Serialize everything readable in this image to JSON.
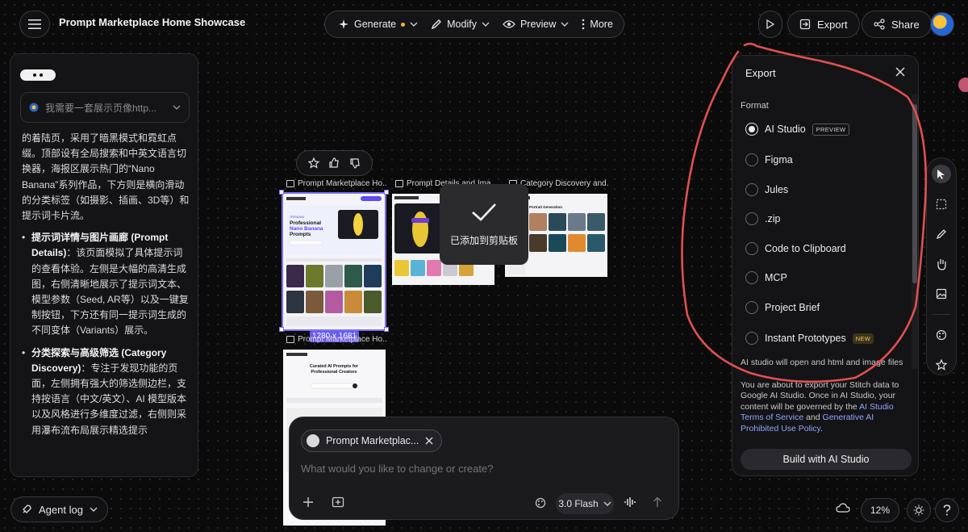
{
  "header": {
    "project_title": "Prompt Marketplace Home Showcase",
    "toolbar": {
      "generate": "Generate",
      "modify": "Modify",
      "preview": "Preview",
      "more": "More"
    },
    "export_label": "Export",
    "share_label": "Share"
  },
  "left_panel": {
    "prompt_preview": "我需要一套展示页像http...",
    "intro_text": "的着陆页，采用了暗黑模式和霓虹点缀。顶部设有全局搜索和中英文语言切换器，海报区展示热门的“Nano Banana”系列作品，下方则是横向滑动的分类标签（如摄影、插画、3D等）和提示词卡片流。",
    "bullets": [
      {
        "title": "提示词详情与图片画廊 (Prompt Details)",
        "body": "：该页面模拟了具体提示词的查看体验。左侧是大幅的高清生成图，右侧清晰地展示了提示词文本、模型参数（Seed, AR等）以及一键复制按钮，下方还有同一提示词生成的不同变体（Variants）展示。"
      },
      {
        "title": "分类探索与高级筛选 (Category Discovery)",
        "body": "：专注于发现功能的页面，左侧拥有强大的筛选侧边栏，支持按语言（中文/英文）、AI 模型版本以及风格进行多维度过滤，右侧则采用瀑布流布局展示精选提示"
      }
    ],
    "agent_log": "Agent log"
  },
  "canvas": {
    "artboards": [
      {
        "label": "Prompt Marketplace Ho...",
        "heading": "Professional Nano Banana Prompts"
      },
      {
        "label": "Prompt Details and Ima..."
      },
      {
        "label": "Category Discovery and...",
        "heading": "Portrait Generation"
      },
      {
        "label": "Prompt Marketplace Ho...",
        "heading": "Curated AI Prompts for Professional Creators"
      }
    ],
    "selection_size": "1280 x 1681",
    "toast": "已添加到剪贴板"
  },
  "chat": {
    "chip_label": "Prompt Marketplac...",
    "placeholder": "What would you like to change or create?",
    "model": "3.0 Flash"
  },
  "export_panel": {
    "title": "Export",
    "format_label": "Format",
    "options": [
      {
        "label": "AI Studio",
        "tag": "PREVIEW",
        "selected": true
      },
      {
        "label": "Figma",
        "selected": false
      },
      {
        "label": "Jules",
        "selected": false
      },
      {
        "label": ".zip",
        "selected": false
      },
      {
        "label": "Code to Clipboard",
        "selected": false
      },
      {
        "label": "MCP",
        "selected": false
      },
      {
        "label": "Project Brief",
        "selected": false
      },
      {
        "label": "Instant Prototypes",
        "tag": "NEW",
        "selected": false
      }
    ],
    "note": "AI studio will open and html and image files",
    "notice_prefix": "You are about to export your Stitch data to Google AI Studio. Once in AI Studio, your content will be governed by the ",
    "terms_link": "AI Studio Terms of Service",
    "notice_and": " and ",
    "policy_link": "Generative AI Prohibited Use Policy",
    "notice_suffix": ".",
    "build_button": "Build with AI Studio"
  },
  "bottom_right": {
    "zoom": "12%"
  },
  "colors": {
    "accent": "#7b6df6",
    "link": "#8fa6ff",
    "annotation": "#e0504f",
    "generate_dot": "#f0b429"
  }
}
